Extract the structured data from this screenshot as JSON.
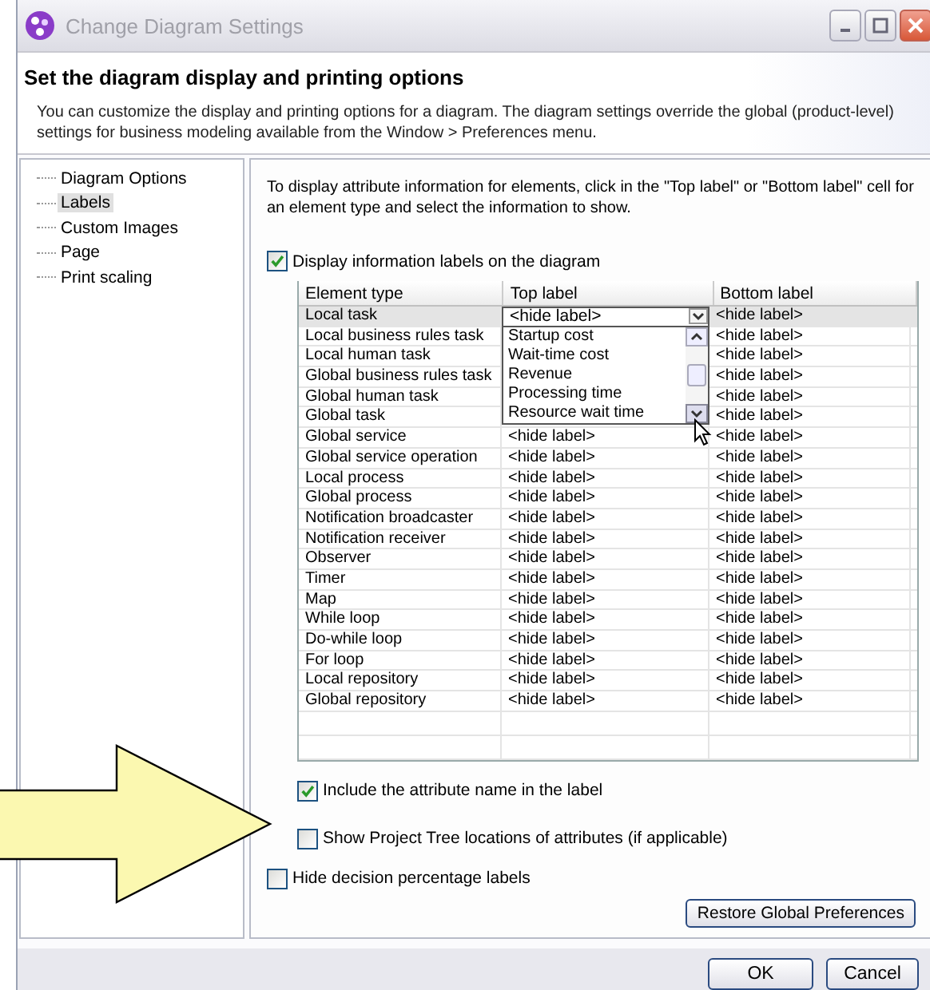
{
  "window": {
    "title": "Change Diagram Settings"
  },
  "header": {
    "title": "Set the diagram display and printing options",
    "description": "You can customize the display and printing options for a diagram. The diagram settings override the global (product-level) settings for business modeling available from the Window > Preferences menu."
  },
  "sidebar": {
    "items": [
      {
        "label": "Diagram Options",
        "selected": false
      },
      {
        "label": "Labels",
        "selected": true
      },
      {
        "label": "Custom Images",
        "selected": false
      },
      {
        "label": "Page",
        "selected": false
      },
      {
        "label": "Print scaling",
        "selected": false
      }
    ]
  },
  "intro": "To display attribute information for elements, click in the \"Top label\" or \"Bottom label\" cell for an element type and select the information to show.",
  "display_labels": {
    "label": "Display information labels on the diagram",
    "checked": true
  },
  "table": {
    "columns": [
      "Element type",
      "Top label",
      "Bottom label"
    ],
    "rows": [
      {
        "element_type": "Local task",
        "top_label": "<hide label>",
        "bottom_label": "<hide label>",
        "selected": true
      },
      {
        "element_type": "Local business rules task",
        "bottom_label": "<hide label>",
        "selected": false
      },
      {
        "element_type": "Local human task",
        "bottom_label": "<hide label>",
        "selected": false
      },
      {
        "element_type": "Global business rules task",
        "bottom_label": "<hide label>",
        "selected": false
      },
      {
        "element_type": "Global human task",
        "bottom_label": "<hide label>",
        "selected": false
      },
      {
        "element_type": "Global task",
        "bottom_label": "<hide label>",
        "selected": false
      },
      {
        "element_type": "Global service",
        "top_label": "<hide label>",
        "bottom_label": "<hide label>",
        "selected": false
      },
      {
        "element_type": "Global service operation",
        "top_label": "<hide label>",
        "bottom_label": "<hide label>",
        "selected": false
      },
      {
        "element_type": "Local process",
        "top_label": "<hide label>",
        "bottom_label": "<hide label>",
        "selected": false
      },
      {
        "element_type": "Global process",
        "top_label": "<hide label>",
        "bottom_label": "<hide label>",
        "selected": false
      },
      {
        "element_type": "Notification broadcaster",
        "top_label": "<hide label>",
        "bottom_label": "<hide label>",
        "selected": false
      },
      {
        "element_type": "Notification receiver",
        "top_label": "<hide label>",
        "bottom_label": "<hide label>",
        "selected": false
      },
      {
        "element_type": "Observer",
        "top_label": "<hide label>",
        "bottom_label": "<hide label>",
        "selected": false
      },
      {
        "element_type": "Timer",
        "top_label": "<hide label>",
        "bottom_label": "<hide label>",
        "selected": false
      },
      {
        "element_type": "Map",
        "top_label": "<hide label>",
        "bottom_label": "<hide label>",
        "selected": false
      },
      {
        "element_type": "While loop",
        "top_label": "<hide label>",
        "bottom_label": "<hide label>",
        "selected": false
      },
      {
        "element_type": "Do-while loop",
        "top_label": "<hide label>",
        "bottom_label": "<hide label>",
        "selected": false
      },
      {
        "element_type": "For loop",
        "top_label": "<hide label>",
        "bottom_label": "<hide label>",
        "selected": false
      },
      {
        "element_type": "Local repository",
        "top_label": "<hide label>",
        "bottom_label": "<hide label>",
        "selected": false
      },
      {
        "element_type": "Global repository",
        "top_label": "<hide label>",
        "bottom_label": "<hide label>",
        "selected": false
      }
    ],
    "dropdown": {
      "options": [
        "Startup cost",
        "Wait-time cost",
        "Revenue",
        "Processing time",
        "Resource wait time"
      ]
    }
  },
  "options": [
    {
      "label": "Include the attribute name in the label",
      "checked": true,
      "indented": true
    },
    {
      "label": "Show Project Tree locations of attributes (if applicable)",
      "checked": false,
      "indented": true
    },
    {
      "label": "Hide decision percentage labels",
      "checked": false,
      "indented": false
    }
  ],
  "restore_button": "Restore Global Preferences",
  "buttons": [
    "OK",
    "Cancel"
  ]
}
